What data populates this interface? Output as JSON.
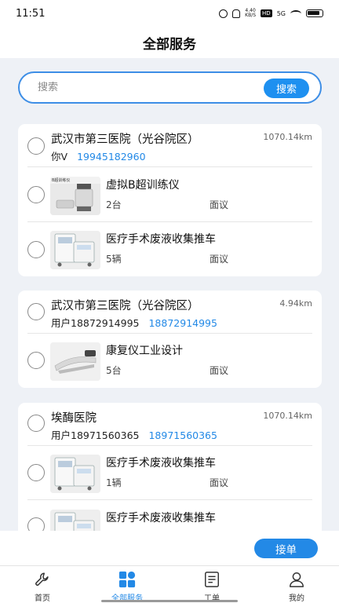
{
  "status_bar": {
    "time": "11:51",
    "speed_top": "4.40",
    "speed_unit": "KB/S",
    "hd": "HD",
    "network": "5G",
    "icons": [
      "alarm-icon",
      "mute-icon",
      "hd-icon",
      "signal-5g-icon",
      "wifi-icon",
      "battery-icon"
    ]
  },
  "header": {
    "title": "全部服务"
  },
  "search": {
    "placeholder": "搜索",
    "button_label": "搜索"
  },
  "orders": [
    {
      "hospital": "武汉市第三医院（光谷院区）",
      "distance": "1070.14km",
      "contact_name": "你V",
      "phone": "19945182960",
      "items": [
        {
          "name": "虚拟B超训练仪",
          "qty": "2台",
          "price": "面议",
          "thumb_label": "B超训练仪"
        },
        {
          "name": "医疗手术废液收集推车",
          "qty": "5辆",
          "price": "面议"
        }
      ]
    },
    {
      "hospital": "武汉市第三医院（光谷院区）",
      "distance": "4.94km",
      "contact_name": "用户18872914995",
      "phone": "18872914995",
      "items": [
        {
          "name": "康复仪工业设计",
          "qty": "5台",
          "price": "面议"
        }
      ]
    },
    {
      "hospital": "埃酶医院",
      "distance": "1070.14km",
      "contact_name": "用户18971560365",
      "phone": "18971560365",
      "items": [
        {
          "name": "医疗手术废液收集推车",
          "qty": "1辆",
          "price": "面议"
        },
        {
          "name": "医疗手术废液收集推车",
          "qty": "",
          "price": ""
        }
      ]
    }
  ],
  "accept_button": "接单",
  "tabs": [
    {
      "label": "首页",
      "icon": "wrench-icon",
      "active": false
    },
    {
      "label": "全部服务",
      "icon": "grid-icon",
      "active": true
    },
    {
      "label": "工单",
      "icon": "document-icon",
      "active": false
    },
    {
      "label": "我的",
      "icon": "user-icon",
      "active": false
    }
  ],
  "colors": {
    "accent": "#2389e6",
    "background": "#eef1f6"
  }
}
